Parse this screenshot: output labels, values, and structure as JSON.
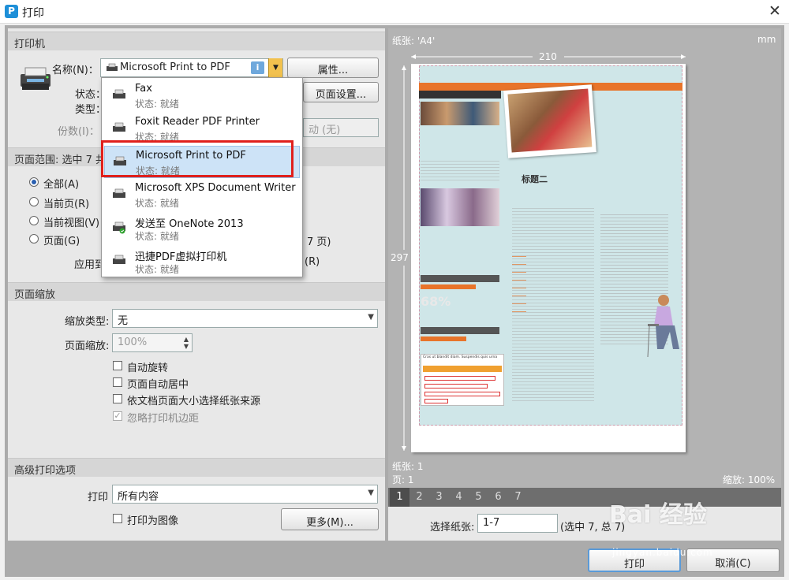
{
  "window": {
    "title": "打印",
    "close_glyph": "✕"
  },
  "printer_section": {
    "header": "打印机",
    "name_label": "名称(N)：",
    "selected_printer": "Microsoft Print to PDF",
    "status_label": "状态：",
    "type_label": "类型：",
    "copies_label": "份数(I)：",
    "properties_button": "属性...",
    "page_setup_button": "页面设置...",
    "hidden_combo_value": "动 (无)"
  },
  "printer_dropdown": {
    "items": [
      {
        "name": "Fax",
        "status": "状态: 就绪",
        "icon": "fax-printer-icon"
      },
      {
        "name": "Foxit Reader PDF Printer",
        "status": "状态: 就绪",
        "icon": "printer-icon"
      },
      {
        "name": "Microsoft Print to PDF",
        "status": "状态: 就绪",
        "icon": "printer-icon",
        "selected": true
      },
      {
        "name": "Microsoft XPS Document Writer",
        "status": "状态: 就绪",
        "icon": "printer-icon"
      },
      {
        "name": "发送至 OneNote 2013",
        "status": "状态: 就绪",
        "icon": "onenote-printer-icon"
      },
      {
        "name": "迅捷PDF虚拟打印机",
        "status": "状态: 就绪",
        "icon": "printer-icon"
      }
    ]
  },
  "page_range": {
    "header": "页面范围: 选中 7 共",
    "options": [
      "全部(A)",
      "当前页(R)",
      "当前视图(V)",
      "页面(G)"
    ],
    "selected_option": "全部(A)",
    "apply_label": "应用到",
    "pages_suffix": "7 页)",
    "r_suffix": "(R)"
  },
  "page_scaling": {
    "header": "页面缩放",
    "scale_type_label": "缩放类型:",
    "scale_type_value": "无",
    "page_scale_label": "页面缩放:",
    "page_scale_value": "100%",
    "auto_rotate": "自动旋转",
    "auto_center": "页面自动居中",
    "paper_source": "依文档页面大小选择纸张来源",
    "ignore_margins": "忽略打印机边距"
  },
  "advanced": {
    "header": "高级打印选项",
    "print_label": "打印",
    "print_value": "所有内容",
    "print_as_image": "打印为图像",
    "more_button": "更多(M)..."
  },
  "preview": {
    "paper_label": "纸张: 'A4'",
    "unit": "mm",
    "width_value": "210",
    "height_value": "297",
    "paper_count": "纸张: 1",
    "page_label": "页: 1",
    "zoom_label": "缩放: 100%",
    "page_tabs": [
      "1",
      "2",
      "3",
      "4",
      "5",
      "6",
      "7"
    ],
    "select_paper_label": "选择纸张:",
    "select_paper_value": "1-7",
    "selected_total": "(选中 7, 总 7)",
    "doc_heading": "标题二",
    "doc_big_number": "68%",
    "doc_snippet": "Cras ut blandit diam. Suspendis quis urna"
  },
  "buttons": {
    "print": "打印",
    "cancel": "取消(C)"
  },
  "watermark": {
    "text": "Bai 经验",
    "url": "jingyan.baidu.com"
  },
  "colors": {
    "highlight_red": "#e0201c",
    "selection_blue": "#cde3f7",
    "doc_orange": "#e8742a",
    "doc_teal": "#cfe6e8"
  }
}
